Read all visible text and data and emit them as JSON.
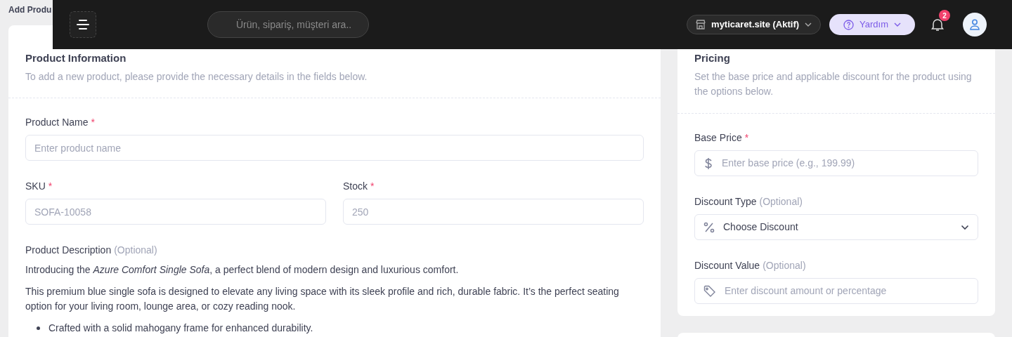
{
  "page_title": "Add Produ",
  "header": {
    "search": {
      "placeholder": "Ürün, sipariş, müşteri ara.."
    },
    "store": "myticaret.site (Aktif)",
    "help": "Yardım",
    "notifications": "2"
  },
  "product_info": {
    "title": "Product Information",
    "subtitle": "To add a new product, please provide the necessary details in the fields below.",
    "fields": [
      {
        "label": "Product Name",
        "required_mark": "*",
        "placeholder": "Enter product name"
      },
      {
        "label": "SKU",
        "required_mark": "*",
        "placeholder": "SOFA-10058"
      },
      {
        "label": "Stock",
        "required_mark": "*",
        "placeholder": "250"
      }
    ],
    "description": {
      "label": "Product Description",
      "hint": "(Optional)",
      "paragraphs": [
        "Introducing the *Azure Comfort Single Sofa*, a perfect blend of modern design and luxurious comfort.",
        "This premium blue single sofa is designed to elevate any living space with its sleek profile and rich, durable fabric. It’s the perfect seating option for your living room, lounge area, or cozy reading nook."
      ],
      "bullets": [
        "Crafted with a solid mahogany frame for enhanced durability."
      ]
    }
  },
  "pricing": {
    "title": "Pricing",
    "subtitle": "Set the base price and applicable discount for the product using the options below.",
    "fields": [
      {
        "kind": "input",
        "label": "Base Price",
        "required_mark": "*",
        "placeholder": "Enter base price (e.g., 199.99)"
      },
      {
        "kind": "select",
        "label": "Discount Type",
        "hint": "(Optional)",
        "value": "Choose Discount"
      },
      {
        "kind": "input",
        "label": "Discount Value",
        "hint": "(Optional)",
        "placeholder": "Enter discount amount or percentage"
      }
    ]
  }
}
